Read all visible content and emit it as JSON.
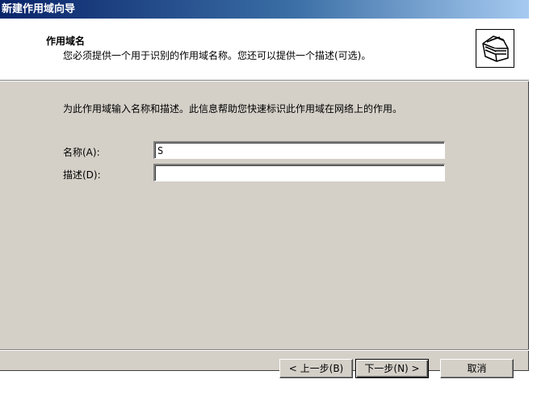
{
  "window": {
    "title": "新建作用域向导"
  },
  "header": {
    "title": "作用域名",
    "subtitle": "您必须提供一个用于识别的作用域名称。您还可以提供一个描述(可选)。",
    "icon": "folders-icon"
  },
  "body": {
    "description": "为此作用域输入名称和描述。此信息帮助您快速标识此作用域在网络上的作用。",
    "name_field": {
      "label": "名称(A):",
      "value": "S"
    },
    "description_field": {
      "label": "描述(D):",
      "value": ""
    }
  },
  "buttons": {
    "back": "< 上一步(B)",
    "next": "下一步(N) >",
    "cancel": "取消"
  },
  "colors": {
    "dialog_bg": "#d4d0c8",
    "title_gradient_start": "#0a246a",
    "title_gradient_end": "#a6caf0"
  }
}
